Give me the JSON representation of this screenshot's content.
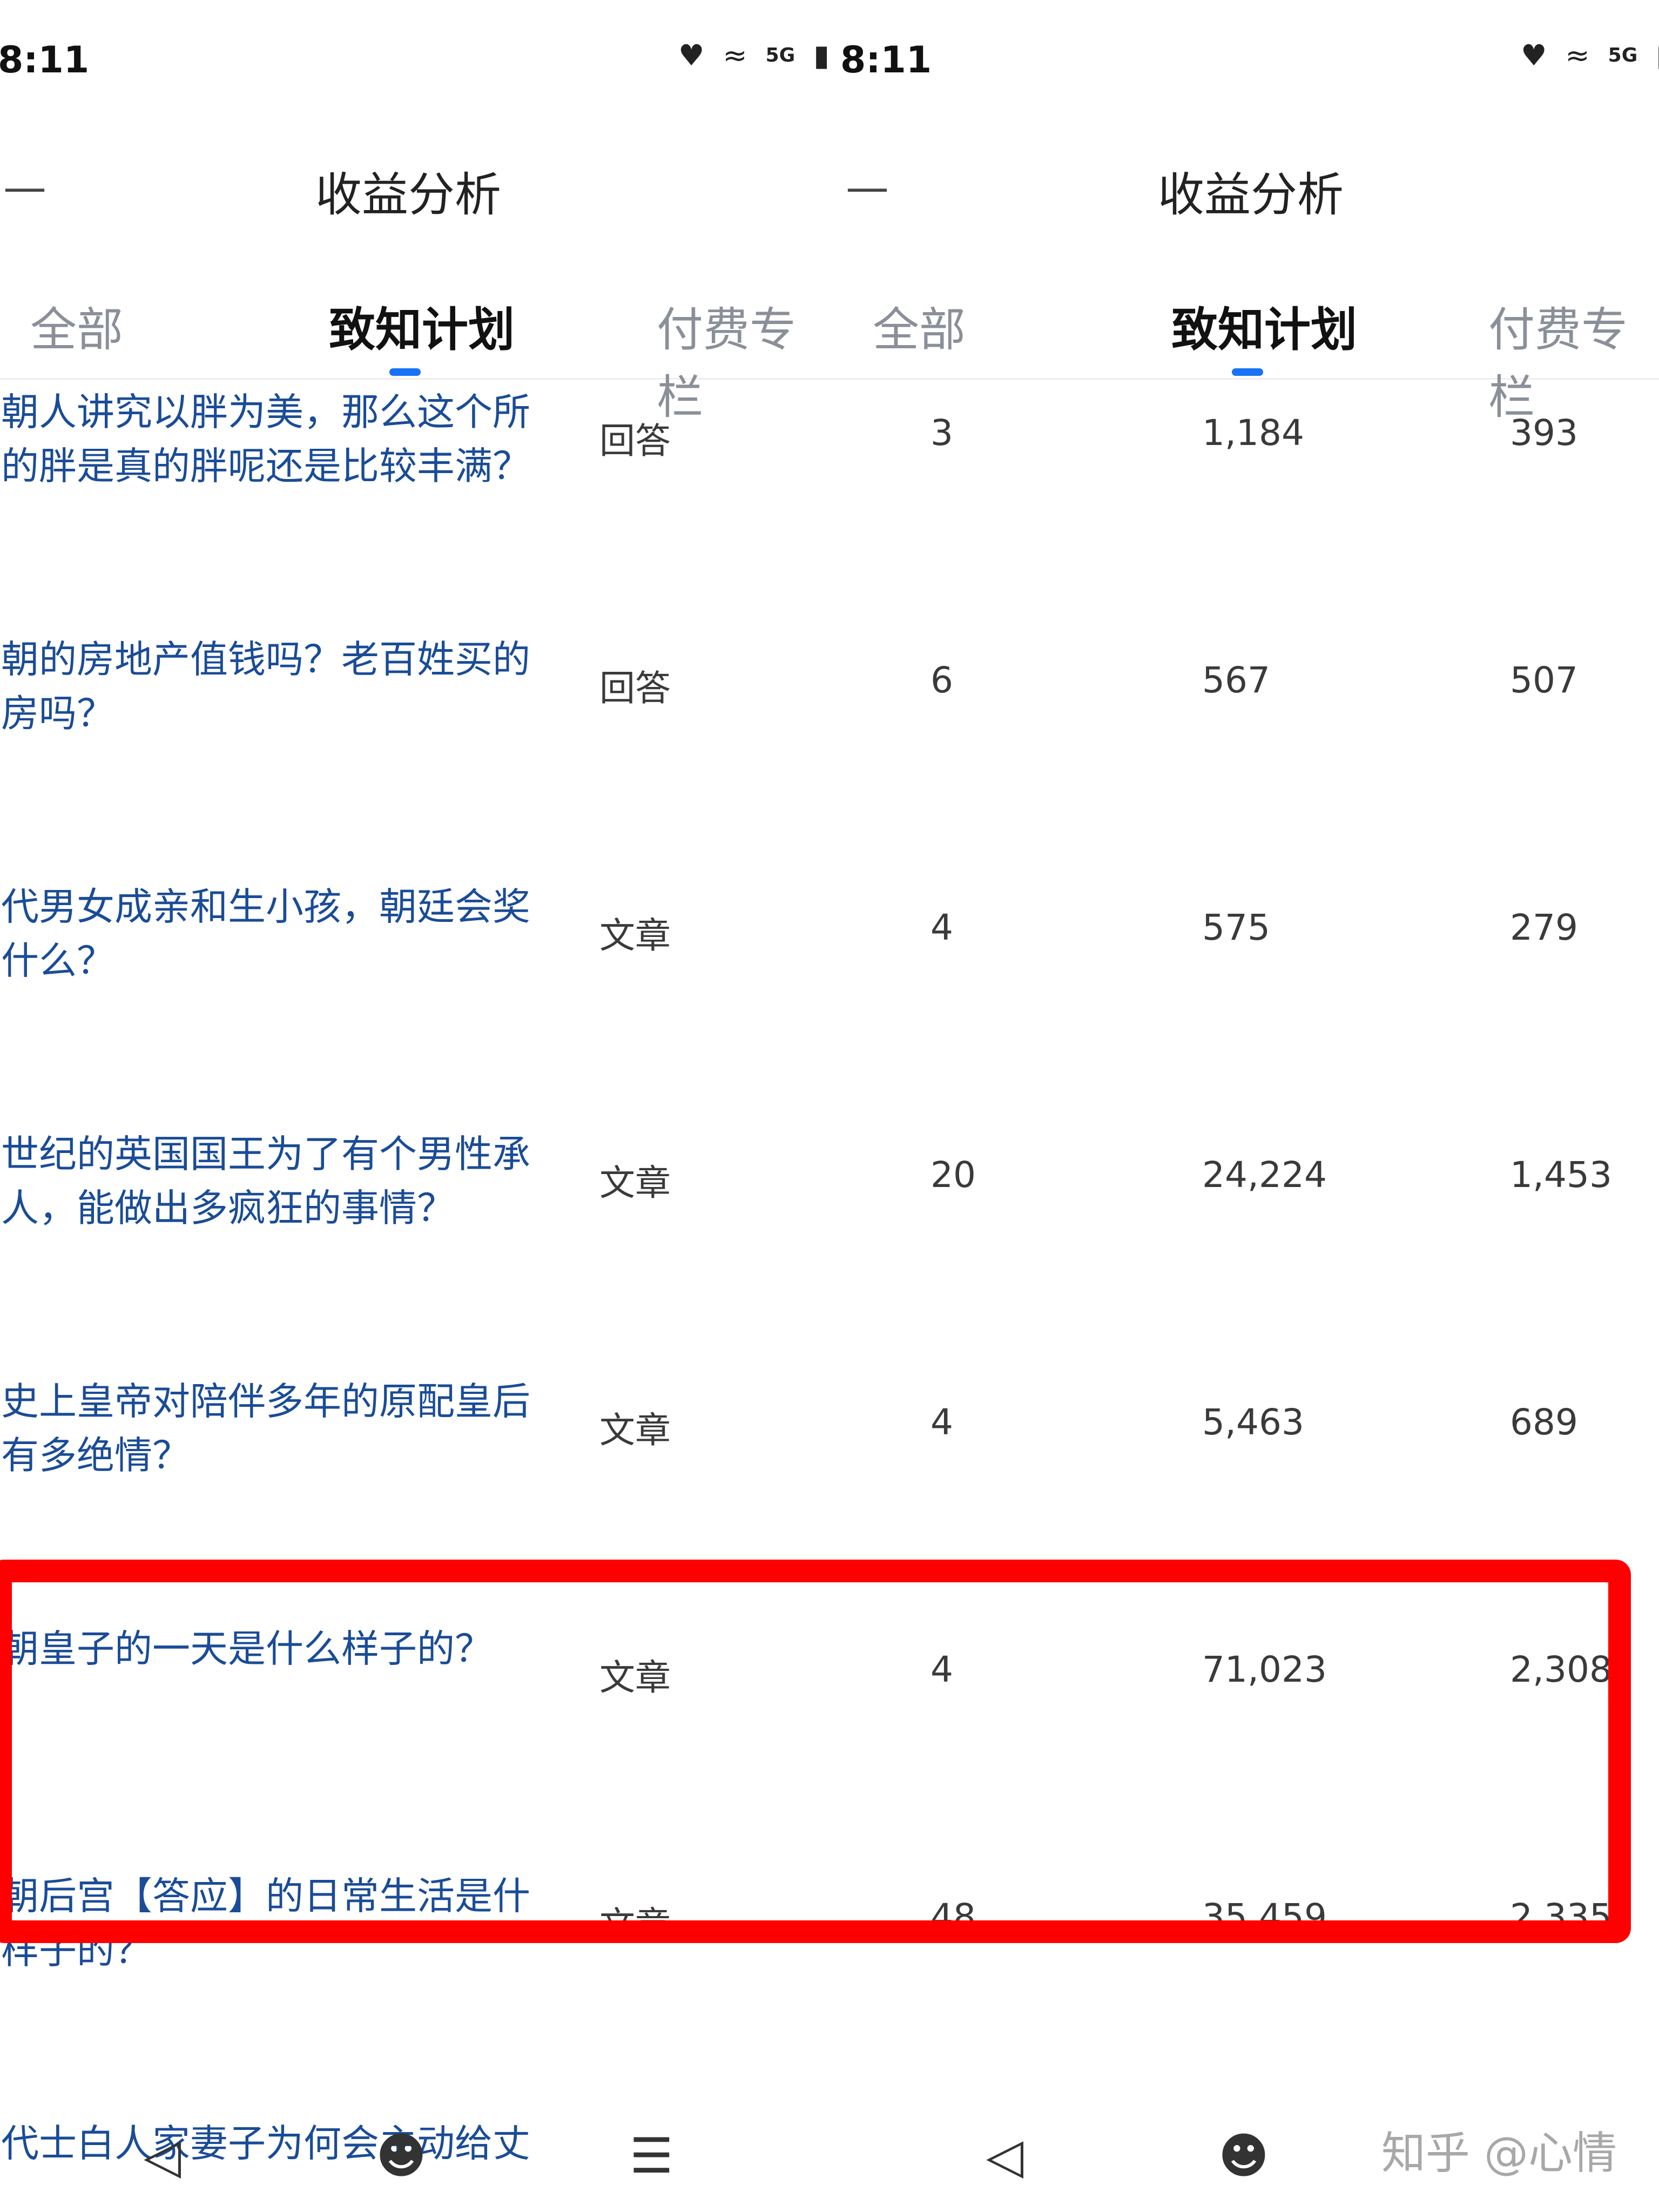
{
  "status_bar": {
    "time": "8:11",
    "signal": "5G"
  },
  "header": {
    "title": "收益分析"
  },
  "tabs": [
    "全部",
    "致知计划",
    "付费专栏"
  ],
  "rows": [
    {
      "question": "朝人讲究以胖为美，那么这个所的胖是真的胖呢还是比较丰满？",
      "type": "回答",
      "col1": "3",
      "col2": "1,184",
      "col3": "393"
    },
    {
      "question": "朝的房地产值钱吗？老百姓买的房吗？",
      "type": "回答",
      "col1": "6",
      "col2": "567",
      "col3": "507"
    },
    {
      "question": "代男女成亲和生小孩，朝廷会奖什么？",
      "type": "文章",
      "col1": "4",
      "col2": "575",
      "col3": "279"
    },
    {
      "question": "世纪的英国国王为了有个男性承人，能做出多疯狂的事情？",
      "type": "文章",
      "col1": "20",
      "col2": "24,224",
      "col3": "1,453"
    },
    {
      "question": "史上皇帝对陪伴多年的原配皇后有多绝情？",
      "type": "文章",
      "col1": "4",
      "col2": "5,463",
      "col3": "689"
    },
    {
      "question": "朝皇子的一天是什么样子的？",
      "type": "文章",
      "col1": "4",
      "col2": "71,023",
      "col3": "2,308"
    },
    {
      "question": "朝后宫【答应】的日常生活是什样子的？",
      "type": "文章",
      "col1": "48",
      "col2": "35,459",
      "col3": "2,335"
    },
    {
      "question": "代士白人家妻子为何会主动给丈",
      "type": "",
      "col1": "",
      "col2": "",
      "col3": ""
    }
  ],
  "watermark": "知乎 @心情",
  "colors": {
    "accent": "#1772f6",
    "link": "#1a4c97",
    "highlight": "#ff0000"
  }
}
